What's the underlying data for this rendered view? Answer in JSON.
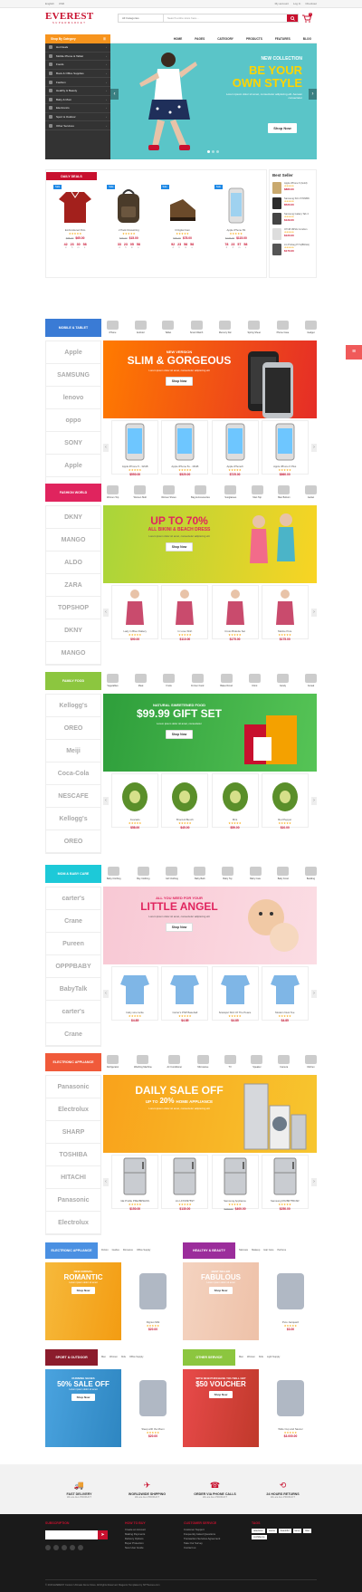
{
  "topbar": {
    "lang": "English",
    "currency": "USD",
    "account": "My account",
    "login": "Log In",
    "checkout": "Checkout"
  },
  "header": {
    "logo": "EVEREST",
    "tagline": "SUPERMARKET",
    "category": "All Categories",
    "search_placeholder": "Search entire store here...",
    "cart_count": "0"
  },
  "nav": {
    "categories_label": "Shop By Category",
    "links": [
      "HOME",
      "PAGES",
      "CATEGORY",
      "PRODUCTS",
      "FEATURES",
      "BLOG"
    ]
  },
  "sidebar": {
    "items": [
      "Hot Deals",
      "Mobile Phone & Tablet",
      "Foods",
      "Book & Office Supplies",
      "Fashion",
      "Healthy & Beauty",
      "Baby & Mom",
      "Electronics",
      "Sport & Outdoor",
      "Other Services"
    ]
  },
  "slider": {
    "kicker": "NEW COLLECTION",
    "title1": "BE YOUR",
    "title2": "OWN STYLE",
    "desc": "Lorem ipsum dolor sit amet, consectetur adipiscing elit. Aenean consectetur",
    "button": "Shop Now"
  },
  "deals": {
    "tag": "DAILY DEALS",
    "badge": "Sale",
    "best_seller": "Best Seller",
    "items": [
      {
        "name": "Embroidered Polo",
        "old": "$85.00",
        "price": "$65.00",
        "timer": [
          "42",
          "23",
          "30",
          "58"
        ]
      },
      {
        "name": "2 Pack Drawstring",
        "old": "$25.00",
        "price": "$15.00",
        "timer": [
          "33",
          "23",
          "05",
          "58"
        ]
      },
      {
        "name": "It Digital Cam",
        "old": "$90.00",
        "price": "$78.00",
        "timer": [
          "92",
          "23",
          "58",
          "58"
        ]
      },
      {
        "name": "Apple iPhone 6S",
        "old": "$125.00",
        "price": "$115.00",
        "timer": [
          "78",
          "23",
          "57",
          "58"
        ]
      }
    ],
    "timer_labels": [
      "d",
      "h",
      "m",
      "s"
    ],
    "sellers": [
      {
        "name": "Apple iPhone 6 (Gold)",
        "price": "$880.00"
      },
      {
        "name": "Samsung SCI-XYNNBN",
        "price": "$520.00"
      },
      {
        "name": "Samsung Galaxy Tab 4",
        "price": "$129.00"
      },
      {
        "name": "Off 48 JMSG Condom",
        "price": "$120.00"
      },
      {
        "name": "LG Probag PYG(BNGH)",
        "price": "$170.00"
      }
    ]
  },
  "mobile": {
    "tag": "MOBILE & TABLET",
    "subcats": [
      "iPhone",
      "Android",
      "Tablet",
      "Smart Watch",
      "Memory Stic",
      "Spring Sheet",
      "Phone Case",
      "Gadget"
    ],
    "brands": [
      "Apple",
      "SAMSUNG",
      "lenovo",
      "oppo",
      "SONY",
      "Apple",
      "SAMSUNG"
    ],
    "banner": {
      "kicker": "NEW VERSION",
      "title": "SLIM & GORGEOUS",
      "desc": "Lorem ipsum dolor sit amet, consectetur adipiscing elit",
      "button": "Shop Now"
    },
    "products": [
      {
        "name": "Apple iPhone 5 - 32GB",
        "price": "$550.00"
      },
      {
        "name": "Apple iPhone 5s - 16GB",
        "price": "$520.00"
      },
      {
        "name": "Apple iPhone6",
        "price": "$725.00"
      },
      {
        "name": "Apple iPhone 6 Plus",
        "price": "$860.00"
      }
    ]
  },
  "fashion": {
    "tag": "FASHION WORLD",
    "subcats": [
      "Women Top",
      "Women Skirt",
      "Women Shoes",
      "Bag & Accessories",
      "Sunglasses",
      "Man Top",
      "Man Bottom",
      "Jacket"
    ],
    "brands": [
      "DKNY",
      "MANGO",
      "ALDO",
      "ZARA",
      "TOPSHOP",
      "DKNY",
      "MANGO"
    ],
    "banner": {
      "title": "UP TO 70%",
      "sub": "ALL BIKINI & BEACH DRESS",
      "desc": "Lorem ipsum dolor sit amet, consectetur adipiscing elit",
      "button": "Shop Now"
    },
    "products": [
      {
        "name": "Lady in Blue Flattery",
        "price": "$90.00"
      },
      {
        "name": "In Love Shirt",
        "price": "$110.00"
      },
      {
        "name": "Cross Bralette Set",
        "price": "$175.00"
      },
      {
        "name": "Marine Pure",
        "price": "$175.00"
      }
    ]
  },
  "food": {
    "tag": "FAMILY FOOD",
    "subcats": [
      "Vegetables",
      "Meat",
      "Fruits",
      "Frozen Food",
      "Baked Food",
      "Drink",
      "Candy",
      "Cereal"
    ],
    "brands": [
      "Kellogg's",
      "OREO",
      "Meiji",
      "Coca-Cola",
      "NESCAFE",
      "Kellogg's",
      "OREO"
    ],
    "banner": {
      "kicker": "NATURAL SWEETENED FOOD",
      "title": "$99.99 GIFT SET",
      "desc": "Lorem ipsum dolor sit amet, consectetur",
      "button": "Shop Now"
    },
    "products": [
      {
        "name": "Avocado",
        "price": "$58.00"
      },
      {
        "name": "Broccoli Bunch",
        "price": "$45.00"
      },
      {
        "name": "Mint",
        "price": "$59.00"
      },
      {
        "name": "Red Pepper",
        "price": "$10.00"
      }
    ]
  },
  "baby": {
    "tag": "MOM & BABY CARE",
    "subcats": [
      "Baby Clothing",
      "Boy Clothing",
      "Girl Clothing",
      "Baby Bath",
      "Baby Toy",
      "Baby Care",
      "Baby Food",
      "Bedding"
    ],
    "brands": [
      "carter's",
      "Crane",
      "Pureen",
      "OPPPBABY",
      "BabyTalk",
      "carter's",
      "Crane"
    ],
    "banner": {
      "kicker": "ALL YOU NEED FOR YOUR",
      "title": "LITTLE ANGEL",
      "desc": "Lorem ipsum dolor sit amet, consectetur adipiscing elit",
      "button": "Shop Now"
    },
    "products": [
      {
        "name": "baby sine lucite",
        "price": "$4.85"
      },
      {
        "name": "Carter's PNP Baseball",
        "price": "$4.85"
      },
      {
        "name": "Scarapul Shirt Of The Peace",
        "price": "$4.85"
      },
      {
        "name": "Modern Nest Tee",
        "price": "$4.85"
      }
    ]
  },
  "electronic": {
    "tag": "ELECTRONIC APPLIANCE",
    "subcats": [
      "Refrigerator",
      "Washing Machine",
      "Air Conditioner",
      "Microwave",
      "TV",
      "Speaker",
      "Camera",
      "Kitchen"
    ],
    "brands": [
      "Panasonic",
      "Electrolux",
      "SHARP",
      "TOSHIBA",
      "HITACHI",
      "Panasonic",
      "Electrolux"
    ],
    "banner": {
      "title": "DAILY SALE OFF",
      "sub_pre": "UP TO",
      "sub_num": "20%",
      "sub_post": "HOME APPLIANCE",
      "desc": "Lorem ipsum dolor sit amet, consectetur adipiscing elit"
    },
    "products": [
      {
        "name": "GE Profile PFE28RSHSS",
        "old": "",
        "price": "$150.00"
      },
      {
        "name": "LG LFX33975ST",
        "old": "",
        "price": "$130.00"
      },
      {
        "name": "Samsung Appliance",
        "old": "$420.00",
        "price": "$400.00"
      },
      {
        "name": "Samsung RF28R7551SR",
        "old": "",
        "price": "$250.00"
      }
    ]
  },
  "mini": [
    {
      "tag": "ELECTRONIC APPLIANCE",
      "tag_color": "#4a90e2",
      "links": [
        "Fiction",
        "Guides",
        "Romance",
        "Office Supply"
      ],
      "banner_kicker": "NEW ARRIVAL",
      "banner_title": "ROMANTIC",
      "banner_desc": "Lorem ipsum dolor sit amet",
      "button": "Shop Now",
      "product": "Dignus Milk",
      "price": "$20.00"
    },
    {
      "tag": "HEALTHY & BEAUTY",
      "tag_color": "#9b2d9b",
      "links": [
        "Skincare",
        "Makeup",
        "Hair Care",
        "Perfume"
      ],
      "banner_kicker": "BEST SELLER",
      "banner_title": "FABULOUS",
      "banner_desc": "Lorem ipsum dolor sit amet",
      "button": "Shop Now",
      "product": "Pure Jacquard",
      "price": "$3.00"
    },
    {
      "tag": "SPORT & OUTDOOR",
      "tag_color": "#8b1c2c",
      "links": [
        "Men",
        "Women",
        "Kids",
        "Office Supply"
      ],
      "banner_kicker": "RUNNING SHOES",
      "banner_title": "50% SALE OFF",
      "banner_desc": "Lorem ipsum dolor sit amet",
      "button": "Shop Now",
      "product": "Sleep with the Moon",
      "price": "$20.00"
    },
    {
      "tag": "OTHER SERVICE",
      "tag_color": "#8cc63f",
      "links": [
        "Men",
        "Women",
        "Kids",
        "Light Supply"
      ],
      "banner_kicker": "WITH $249 PURCHASE YOU WILL GET",
      "banner_title": "$50 VOUCHER",
      "banner_desc": "",
      "button": "Shop Now",
      "product": "Wide Cup and Saucer",
      "price": "$3.000.00"
    }
  ],
  "features": [
    {
      "title": "FAST DELIVERY",
      "desc": "We are ALL PRODUCT"
    },
    {
      "title": "WORLDWIDE SHIPPING",
      "desc": "We are ALL PRODUCT"
    },
    {
      "title": "ORDER VIA PHONE CALLS",
      "desc": "We are ALL PRODUCT"
    },
    {
      "title": "24 HOURS RETURNS",
      "desc": "We are ALL PRODUCT"
    }
  ],
  "footer": {
    "subscription": "SUBSCRIPTION",
    "how_to_buy": "HOW TO BUY",
    "how_links": [
      "Create an Account",
      "Making Payments",
      "Delivery Options",
      "Buyer Protection",
      "New User Guide"
    ],
    "customer": "CUSTOMER SERVICE",
    "cust_links": [
      "Customer Support",
      "Frequently Asked Questions",
      "Transaction Services Agreement",
      "Take Our Survey",
      "Contact us"
    ],
    "tags": "TAGS",
    "tag_list": [
      "television",
      "ovens",
      "beautiful",
      "lamp",
      "bike",
      "confidence"
    ],
    "copyright": "© 2016 EVEREST Custom Ultimate Demo Store. All Rights Reserved. Magento Templates by SPThemes.com"
  }
}
